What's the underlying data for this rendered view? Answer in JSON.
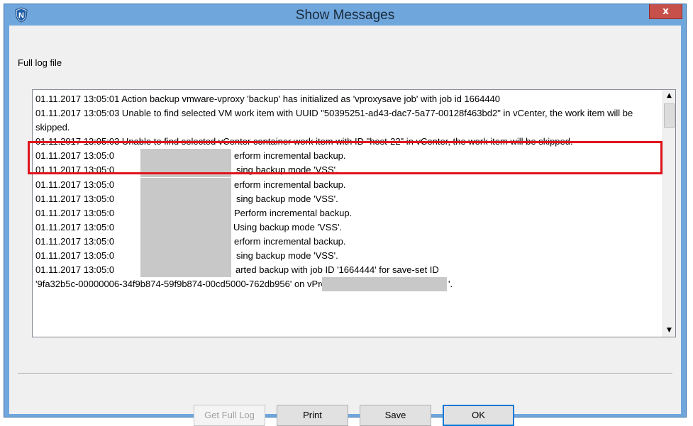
{
  "window": {
    "title": "Show Messages",
    "close_label": "x",
    "accent_color": "#6fa6dc",
    "app_icon": "shield-n-icon",
    "app_icon_letter": "N"
  },
  "label": {
    "full_log": "Full log file"
  },
  "log": {
    "lines": [
      "01.11.2017 13:05:01 Action backup vmware-vproxy 'backup' has initialized as 'vproxysave job' with job id 1664440",
      "01.11.2017 13:05:03 Unable to find selected VM work item with UUID \"50395251-ad43-dac7-5a77-00128f463bd2\" in vCenter, the work item will be skipped.",
      "01.11.2017 13:05:03 Unable to find selected vCenter container work item with ID \"host-22\" in vCenter, the work item will be skipped.",
      [
        "01.11.2017 13:05:0",
        "erform incremental backup."
      ],
      [
        "01.11.2017 13:05:0",
        "sing backup mode 'VSS'."
      ],
      [
        "01.11.2017 13:05:0",
        "erform incremental backup."
      ],
      [
        "01.11.2017 13:05:0",
        "sing backup mode 'VSS'."
      ],
      [
        "01.11.2017 13:05:0",
        "Perform incremental backup."
      ],
      [
        "01.11.2017 13:05:0",
        "Using backup mode 'VSS'."
      ],
      [
        "01.11.2017 13:05:0",
        "erform incremental backup."
      ],
      [
        "01.11.2017 13:05:0",
        "sing backup mode 'VSS'."
      ],
      [
        "01.11.2017 13:05:0",
        "arted backup with job ID '1664444' for save-set ID"
      ],
      [
        "'9fa32b5c-00000006-34f9b874-59f9b874-00cd5000-762db956' on vProxy",
        "'."
      ]
    ],
    "highlight_color": "#e0141b"
  },
  "buttons": {
    "get_full_log": "Get Full Log",
    "print": "Print",
    "save": "Save",
    "ok": "OK"
  }
}
